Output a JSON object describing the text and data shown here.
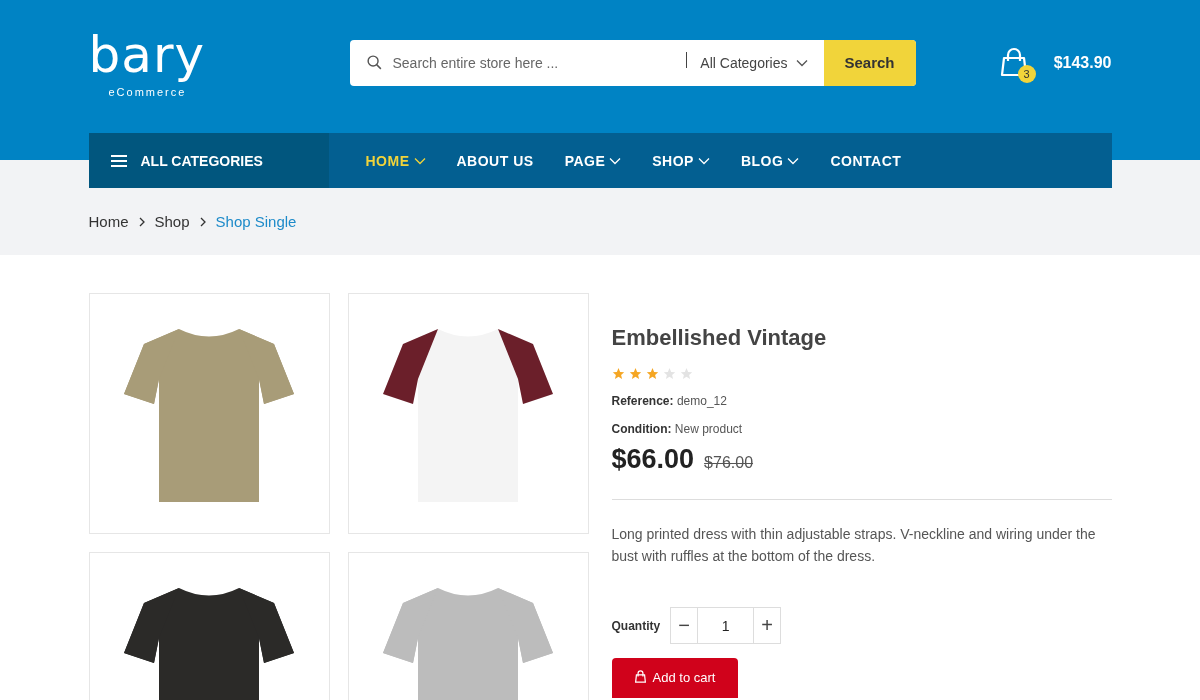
{
  "logo": {
    "name": "bary",
    "tagline": "eCommerce"
  },
  "search": {
    "placeholder": "Search entire store here ...",
    "category": "All Categories",
    "button": "Search"
  },
  "cart": {
    "count": "3",
    "total": "$143.90"
  },
  "categories_button": "ALL CATEGORIES",
  "nav": [
    {
      "label": "HOME",
      "selected": true,
      "dropdown": true
    },
    {
      "label": "ABOUT US",
      "selected": false,
      "dropdown": false
    },
    {
      "label": "PAGE",
      "selected": false,
      "dropdown": true
    },
    {
      "label": "SHOP",
      "selected": false,
      "dropdown": true
    },
    {
      "label": "BLOG",
      "selected": false,
      "dropdown": true
    },
    {
      "label": "CONTACT",
      "selected": false,
      "dropdown": false
    }
  ],
  "breadcrumb": [
    {
      "label": "Home",
      "selected": false
    },
    {
      "label": "Shop",
      "selected": false
    },
    {
      "label": "Shop Single",
      "selected": true
    }
  ],
  "product": {
    "title": "Embellished Vintage",
    "stars": 3,
    "details": [
      {
        "label": "Reference:",
        "value": "demo_12"
      },
      {
        "label": "Condition:",
        "value": "New product"
      }
    ],
    "price": "$66.00",
    "old_price": "$76.00",
    "description": "Long printed dress with thin adjustable straps. V-neckline and wiring under the bust with ruffles at the bottom of the dress.",
    "quantity_label": "Quantity",
    "quantity": "1",
    "minus": "−",
    "plus": "+",
    "add_to_cart": "Add to cart"
  }
}
